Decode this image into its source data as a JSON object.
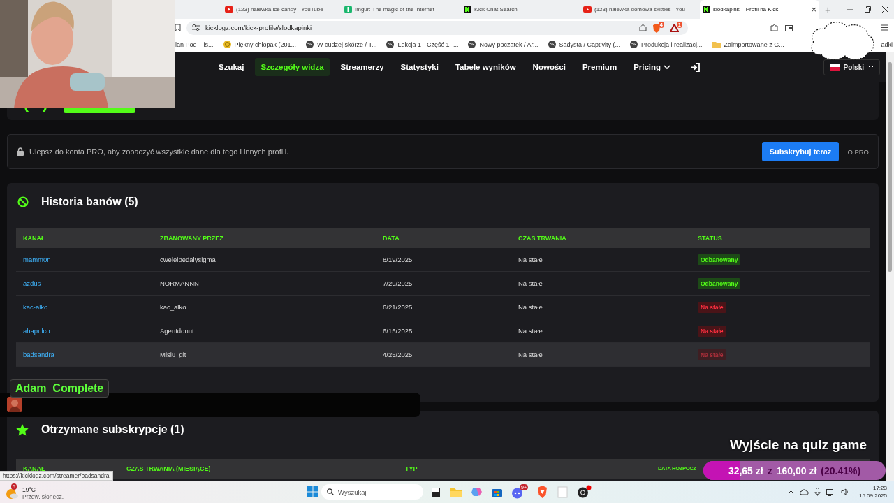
{
  "browser": {
    "tabs": [
      {
        "title": "(123) nalewka ice candy - YouTube",
        "kind": "video",
        "selected": false
      },
      {
        "title": "Imgur: The magic of the Internet",
        "kind": "imgur",
        "selected": false
      },
      {
        "title": "Kick Chat Search",
        "kind": "kick",
        "selected": false
      },
      {
        "title": "(123) nalewka domowa skittles - You",
        "kind": "video",
        "selected": false
      },
      {
        "title": "slodkapinki - Profil na Kick",
        "kind": "kick",
        "selected": true
      }
    ],
    "new_tab": "+",
    "close_tab": "×",
    "address": "kicklogz.com/kick-profile/slodkapinki",
    "shield_badge": "4",
    "alert_badge": "1",
    "bookmarks": [
      {
        "label": "lan Poe - lis...",
        "kind": "plain"
      },
      {
        "label": "Piękny chłopak (201...",
        "kind": "smiley"
      },
      {
        "label": "W cudzej skórze / T...",
        "kind": "globe"
      },
      {
        "label": "Lekcja 1 - Część 1 -...",
        "kind": "globe"
      },
      {
        "label": "Nowy początek / Ar...",
        "kind": "globe"
      },
      {
        "label": "Sadysta / Captivity (...",
        "kind": "globe"
      },
      {
        "label": "Produkcja i realizacj...",
        "kind": "globe"
      },
      {
        "label": "Zaimportowane z G...",
        "kind": "folder"
      },
      {
        "label": "adki",
        "kind": "plain"
      }
    ]
  },
  "nav": {
    "items": [
      {
        "label": "Szukaj",
        "selected": false
      },
      {
        "label": "Szczegóły widza",
        "selected": true
      },
      {
        "label": "Streamerzy",
        "selected": false
      },
      {
        "label": "Statystyki",
        "selected": false
      },
      {
        "label": "Tabele wyników",
        "selected": false
      },
      {
        "label": "Nowości",
        "selected": false
      },
      {
        "label": "Premium",
        "selected": false
      },
      {
        "label": "Pricing",
        "selected": false,
        "dropdown": true
      }
    ],
    "language": "Polski"
  },
  "pro_banner": {
    "text": "Ulepsz do konta PRO, aby zobaczyć wszystkie dane dla tego i innych profili.",
    "button": "Subskrybuj teraz",
    "link": "O PRO"
  },
  "bans": {
    "title": "Historia banów (5)",
    "columns": [
      "KANAŁ",
      "ZBANOWANY PRZEZ",
      "DATA",
      "CZAS TRWANIA",
      "STATUS"
    ],
    "rows": [
      {
        "channel": "mamm0n",
        "banned_by": "cweleipedalysigma",
        "date": "8/19/2025",
        "duration": "Na stałe",
        "status": "Odbanowany",
        "kind": "unbanned",
        "highlighted": false
      },
      {
        "channel": "azdus",
        "banned_by": "NORMANNN",
        "date": "7/29/2025",
        "duration": "Na stałe",
        "status": "Odbanowany",
        "kind": "unbanned",
        "highlighted": false
      },
      {
        "channel": "kac-alko",
        "banned_by": "kac_alko",
        "date": "6/21/2025",
        "duration": "Na stałe",
        "status": "Na stałe",
        "kind": "permanent",
        "highlighted": false
      },
      {
        "channel": "ahapulco",
        "banned_by": "Agentdonut",
        "date": "6/15/2025",
        "duration": "Na stałe",
        "status": "Na stałe",
        "kind": "permanent",
        "highlighted": false
      },
      {
        "channel": "badsandra",
        "banned_by": "Misiu_git",
        "date": "4/25/2025",
        "duration": "Na stałe",
        "status": "Na stałe",
        "kind": "permanent",
        "highlighted": true
      }
    ]
  },
  "subs": {
    "title": "Otrzymane subskrypcje (1)",
    "columns": [
      "KANAŁ",
      "CZAS TRWANIA (MIESIĄCE)",
      "TYP",
      "DATA ROZPOCZ"
    ]
  },
  "chat_overlay": {
    "user": "Adam_Complete"
  },
  "goal_overlay": {
    "title": "Wyjście na quiz game",
    "current": "32,65 zł",
    "separator": "z",
    "target": "160,00 zł",
    "percent": "(20.41%)",
    "level": 0.2041
  },
  "status_url": "https://kicklogz.com/streamer/badsandra",
  "taskbar": {
    "weather_badge": "5",
    "temperature": "19°C",
    "weather": "Przew. słonecz.",
    "search_placeholder": "Wyszukaj",
    "chat_badge": "9+",
    "time": "17:23",
    "date": "15.09.2025"
  }
}
